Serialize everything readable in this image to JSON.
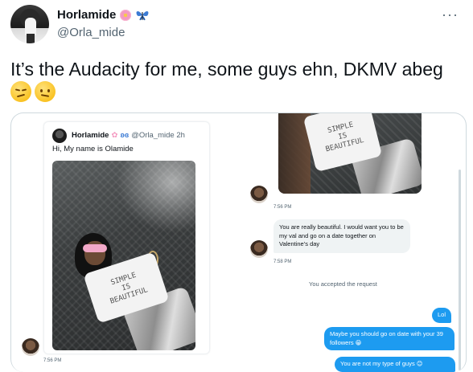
{
  "tweet": {
    "display_name": "Horlamide",
    "name_emojis": [
      "cherry-blossom-icon",
      "butterfly-icon"
    ],
    "handle": "@Orla_mide",
    "more_label": "···",
    "text": "It’s the Audacity for me, some guys ehn, DKMV abeg",
    "text_emojis": [
      "smirk-face-icon",
      "confused-face-icon"
    ]
  },
  "screenshot": {
    "quote": {
      "name": "Horlamide",
      "handle_time": "@Orla_mide 2h",
      "text": "Hi, My name is Olamide",
      "shirt_text": [
        "SIMPLE",
        "IS",
        "BEAUTIFUL"
      ]
    },
    "left_time": "7:56 PM",
    "dm": {
      "photo_shirt_text": [
        "SIMPLE",
        "IS",
        "BEAUTIFUL"
      ],
      "time1": "7:56 PM",
      "incoming": "You are really beautiful. I would want you to be my val and go on a date together on Valentine’s day",
      "time2": "7:58 PM",
      "system": "You accepted the request",
      "outgoing": [
        "Lol",
        "Maybe you should go on date with your 39 followers 😁",
        "You are not my type of guys 😊"
      ]
    }
  },
  "colors": {
    "accent": "#1d9bf0",
    "text": "#0f1419",
    "muted": "#536471"
  }
}
